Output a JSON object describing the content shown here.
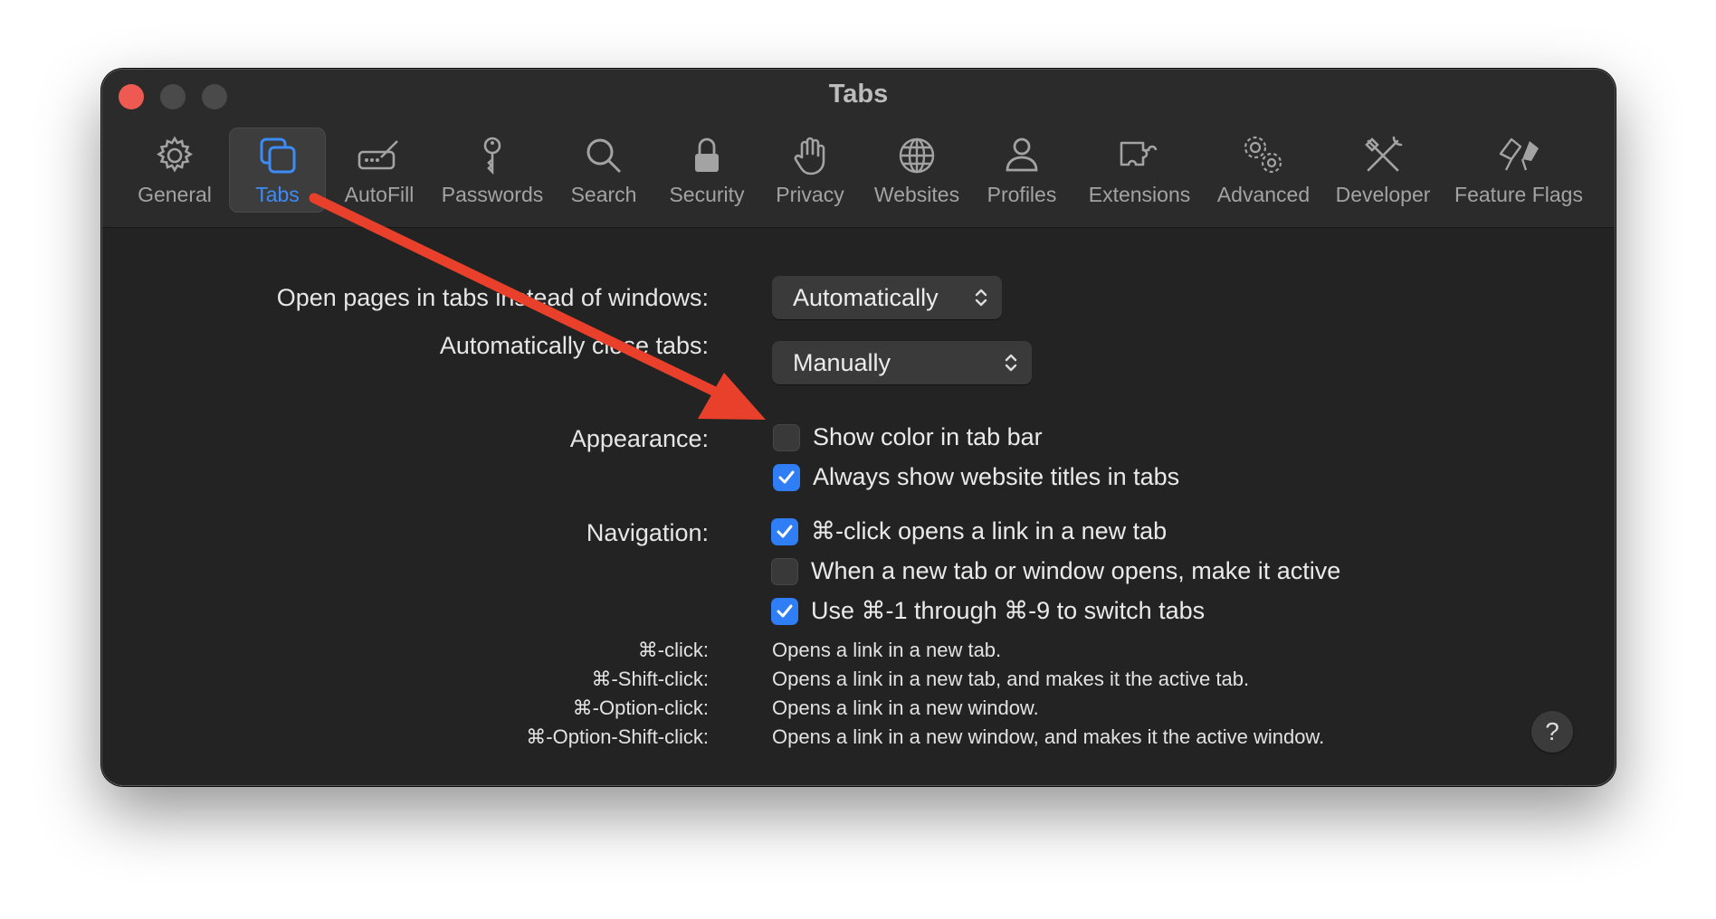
{
  "window": {
    "title": "Tabs"
  },
  "toolbar": {
    "tabs": [
      {
        "label": "General",
        "icon": "gear-icon"
      },
      {
        "label": "Tabs",
        "icon": "tabs-icon",
        "active": true
      },
      {
        "label": "AutoFill",
        "icon": "autofill-icon"
      },
      {
        "label": "Passwords",
        "icon": "key-icon"
      },
      {
        "label": "Search",
        "icon": "search-icon"
      },
      {
        "label": "Security",
        "icon": "lock-icon"
      },
      {
        "label": "Privacy",
        "icon": "hand-icon"
      },
      {
        "label": "Websites",
        "icon": "globe-icon"
      },
      {
        "label": "Profiles",
        "icon": "person-icon"
      },
      {
        "label": "Extensions",
        "icon": "puzzle-icon"
      },
      {
        "label": "Advanced",
        "icon": "gears-icon"
      },
      {
        "label": "Developer",
        "icon": "tools-icon"
      },
      {
        "label": "Feature Flags",
        "icon": "flags-icon"
      }
    ]
  },
  "settings": {
    "open_pages_label": "Open pages in tabs instead of windows:",
    "open_pages_value": "Automatically",
    "close_tabs_label": "Automatically close tabs:",
    "close_tabs_value": "Manually",
    "appearance_label": "Appearance:",
    "appearance_options": [
      {
        "label": "Show color in tab bar",
        "checked": false
      },
      {
        "label": "Always show website titles in tabs",
        "checked": true
      }
    ],
    "navigation_label": "Navigation:",
    "navigation_options": [
      {
        "label": "⌘-click opens a link in a new tab",
        "checked": true
      },
      {
        "label": "When a new tab or window opens, make it active",
        "checked": false
      },
      {
        "label": "Use ⌘-1 through ⌘-9 to switch tabs",
        "checked": true
      }
    ]
  },
  "shortcuts": [
    {
      "key": "⌘-click:",
      "desc": "Opens a link in a new tab."
    },
    {
      "key": "⌘-Shift-click:",
      "desc": "Opens a link in a new tab, and makes it the active tab."
    },
    {
      "key": "⌘-Option-click:",
      "desc": "Opens a link in a new window."
    },
    {
      "key": "⌘-Option-Shift-click:",
      "desc": "Opens a link in a new window, and makes it the active window."
    }
  ],
  "help": {
    "label": "?"
  },
  "colors": {
    "accent": "#3b8cf6",
    "checkbox_on": "#2f7ef6",
    "annotation_arrow": "#e8402a",
    "close_button": "#ee5a52"
  }
}
